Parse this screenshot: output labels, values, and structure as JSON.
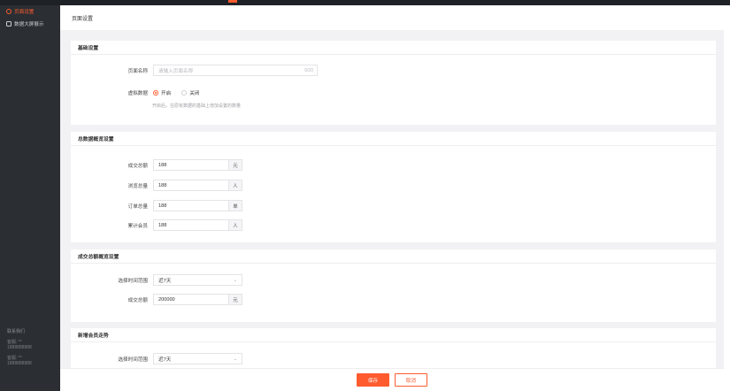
{
  "sidebar": {
    "items": [
      {
        "label": "页面设置",
        "icon": "gear-icon",
        "active": true
      },
      {
        "label": "数据大屏展示",
        "icon": "monitor-icon",
        "active": false
      }
    ],
    "contact": {
      "label": "联系我们",
      "entries": [
        {
          "name": "客服: **",
          "phone": "1888888888"
        },
        {
          "name": "客服: **",
          "phone": "1888888888"
        }
      ]
    }
  },
  "header": {
    "title": "页面设置"
  },
  "basic": {
    "title": "基础设置",
    "page_name_label": "页面名称",
    "page_name_placeholder": "请输入页面名称",
    "page_name_counter": "0/20",
    "virtual_label": "虚拟数据",
    "opt_on": "开启",
    "opt_off": "关闭",
    "hint": "开启后，在原有数据的基础上增加设置的数量"
  },
  "overview": {
    "title": "总数据概览设置",
    "rows": [
      {
        "label": "成交总额",
        "value": "188",
        "unit": "元"
      },
      {
        "label": "浏览总量",
        "value": "188",
        "unit": "人"
      },
      {
        "label": "订单总量",
        "value": "188",
        "unit": "单"
      },
      {
        "label": "累计会员",
        "value": "188",
        "unit": "人"
      }
    ]
  },
  "deal": {
    "title": "成交总额概览设置",
    "range_label": "选择时间范围",
    "range_value": "近7天",
    "total_label": "成交总额",
    "total_value": "200000",
    "total_unit": "元"
  },
  "members": {
    "title": "新增会员走势",
    "range_label": "选择时间范围",
    "range_value": "近7天"
  },
  "footer": {
    "save": "保存",
    "cancel": "取消"
  },
  "colors": {
    "accent": "#ff5b2e",
    "sidebar": "#2b2f33"
  }
}
